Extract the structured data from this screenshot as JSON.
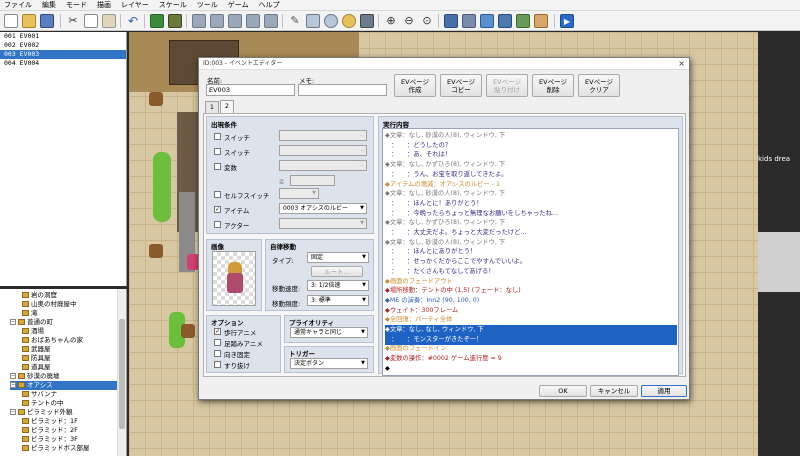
{
  "menu": [
    "ファイル",
    "編集",
    "モード",
    "描画",
    "レイヤー",
    "スケール",
    "ツール",
    "ゲーム",
    "ヘルプ"
  ],
  "events": [
    "001 EV001",
    "002 EV002",
    "003 EV003",
    "004 EV004"
  ],
  "selected_event_index": 2,
  "tree": [
    {
      "label": "岩の洞窟",
      "indent": 2,
      "expander": false
    },
    {
      "label": "山奥の村廃屋中",
      "indent": 2,
      "expander": false
    },
    {
      "label": "滝",
      "indent": 2,
      "expander": false
    },
    {
      "label": "普通の町",
      "indent": 1,
      "expander": true
    },
    {
      "label": "酒場",
      "indent": 2,
      "expander": false
    },
    {
      "label": "おばあちゃんの家",
      "indent": 2,
      "expander": false
    },
    {
      "label": "武器屋",
      "indent": 2,
      "expander": false
    },
    {
      "label": "防具屋",
      "indent": 2,
      "expander": false
    },
    {
      "label": "道具屋",
      "indent": 2,
      "expander": false
    },
    {
      "label": "砂漠の廃墟",
      "indent": 1,
      "expander": true
    },
    {
      "label": "オアシス",
      "indent": 1,
      "expander": true,
      "selected": true
    },
    {
      "label": "サバンナ",
      "indent": 2,
      "expander": false
    },
    {
      "label": "テントの中",
      "indent": 2,
      "expander": false
    },
    {
      "label": "ピラミッド外観",
      "indent": 1,
      "expander": true
    },
    {
      "label": "ピラミッド：1F",
      "indent": 2,
      "expander": false
    },
    {
      "label": "ピラミッド：2F",
      "indent": 2,
      "expander": false
    },
    {
      "label": "ピラミッド：3F",
      "indent": 2,
      "expander": false
    },
    {
      "label": "ピラミッドボス部屋",
      "indent": 2,
      "expander": false
    }
  ],
  "right_text": "kids drea",
  "dialog": {
    "title": "ID:003 - イベントエディター",
    "close": "×",
    "name_label": "名前:",
    "name_value": "EV003",
    "memo_label": "メモ:",
    "memo_value": "",
    "page_buttons": [
      {
        "l1": "EVページ",
        "l2": "作成",
        "disabled": false
      },
      {
        "l1": "EVページ",
        "l2": "コピー",
        "disabled": false
      },
      {
        "l1": "EVページ",
        "l2": "貼り付け",
        "disabled": true
      },
      {
        "l1": "EVページ",
        "l2": "削除",
        "disabled": false
      },
      {
        "l1": "EVページ",
        "l2": "クリア",
        "disabled": false
      }
    ],
    "tabs": [
      "1",
      "2"
    ],
    "active_tab": 1,
    "conditions": {
      "title": "出現条件",
      "switch1": "スイッチ",
      "switch2": "スイッチ",
      "variable": "変数",
      "ge": "≧",
      "self_switch": "セルフスイッチ",
      "item": "アイテム",
      "item_value": "0003 オアシスのルビー",
      "actor": "アクター",
      "dots": "..."
    },
    "image_title": "画像",
    "autonomous": {
      "title": "自律移動",
      "type_label": "タイプ:",
      "type_value": "固定",
      "route_button": "ルート...",
      "speed_label": "移動速度:",
      "speed_value": "3: 1/2倍速",
      "freq_label": "移動頻度:",
      "freq_value": "3: 標準"
    },
    "options": {
      "title": "オプション",
      "items": [
        {
          "label": "歩行アニメ",
          "checked": true
        },
        {
          "label": "足踏みアニメ",
          "checked": false
        },
        {
          "label": "向き固定",
          "checked": false
        },
        {
          "label": "すり抜け",
          "checked": false
        }
      ]
    },
    "priority": {
      "title": "プライオリティ",
      "value": "通常キャラと同じ"
    },
    "trigger": {
      "title": "トリガー",
      "value": "決定ボタン"
    },
    "contents_title": "実行内容",
    "contents": [
      {
        "t": "◆文章：なし, 砂漠の人(8), ウィンドウ, 下",
        "c": "#7a7a7a"
      },
      {
        "t": "　：　　：どうしたの？",
        "c": "#3b2a8a"
      },
      {
        "t": "　：　　：あ、それは！",
        "c": "#3b2a8a"
      },
      {
        "t": "◆文章：なし, かずひろ(8), ウィンドウ, 下",
        "c": "#7a7a7a"
      },
      {
        "t": "　：　　：うん、お宝を取り返してきたよ。",
        "c": "#3b2a8a"
      },
      {
        "t": "◆アイテムの増減：オアシスのルビー - 1",
        "c": "#c98a2a"
      },
      {
        "t": "◆文章：なし, 砂漠の人(8), ウィンドウ, 下",
        "c": "#7a7a7a"
      },
      {
        "t": "　：　　：ほんとに！ありがとう！",
        "c": "#3b2a8a"
      },
      {
        "t": "　：　　：今晩ったらちょっと無理なお願いをしちゃったね…",
        "c": "#3b2a8a"
      },
      {
        "t": "◆文章：なし, かずひろ(8), ウィンドウ, 下",
        "c": "#7a7a7a"
      },
      {
        "t": "　：　　：大丈夫だよ。ちょっと大変だったけど…",
        "c": "#3b2a8a"
      },
      {
        "t": "◆文章：なし, 砂漠の人(8), ウィンドウ, 下",
        "c": "#7a7a7a"
      },
      {
        "t": "　：　　：ほんとにありがとう！",
        "c": "#3b2a8a"
      },
      {
        "t": "　：　　：せっかくだからここでやすんでいいよ。",
        "c": "#3b2a8a"
      },
      {
        "t": "　：　　：たくさんもてなしてあげる！",
        "c": "#3b2a8a"
      },
      {
        "t": "◆画面のフェードアウト",
        "c": "#c98a2a"
      },
      {
        "t": "◆場所移動：テントの中 (1,5) (フェード：なし)",
        "c": "#b01e1e"
      },
      {
        "t": "◆ME の演奏：Inn2 (90, 100, 0)",
        "c": "#2a5fb0"
      },
      {
        "t": "◆ウェイト：300フレーム",
        "c": "#b01e1e"
      },
      {
        "t": "◆全回復：パーティ全体",
        "c": "#c98a2a"
      },
      {
        "t": "◆文章：なし, なし, ウィンドウ, 下",
        "c": "#ffffff",
        "hl": true
      },
      {
        "t": "　：　　：モンスターがきたぞー！",
        "c": "#ffffff",
        "hl": true
      },
      {
        "t": "◆画面のフェードイン",
        "c": "#c98a2a"
      },
      {
        "t": "◆変数の操作：#0002 ゲーム進行度 = 9",
        "c": "#b01e1e"
      },
      {
        "t": "◆",
        "c": "#000000"
      }
    ],
    "ok": "OK",
    "cancel": "キャンセル",
    "apply": "適用"
  }
}
